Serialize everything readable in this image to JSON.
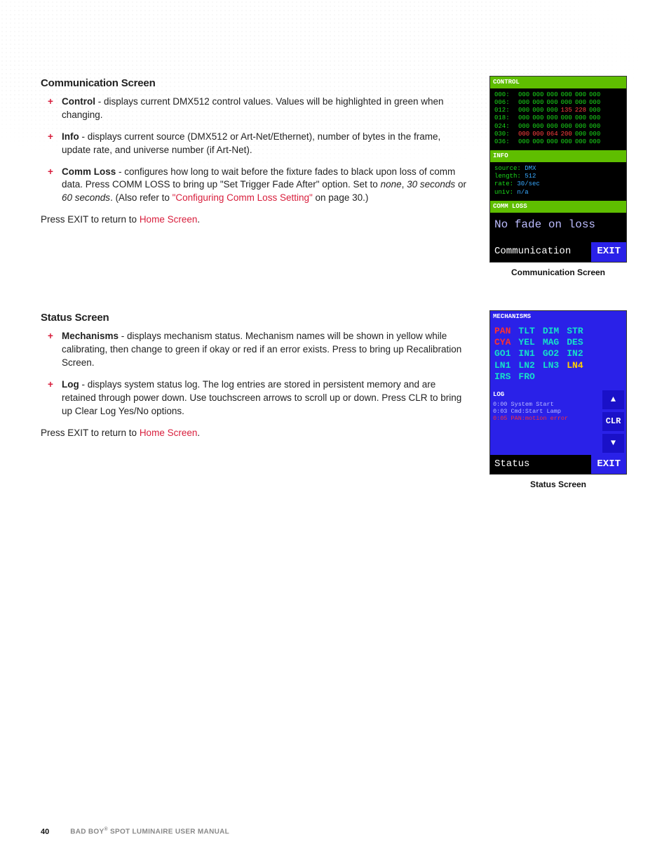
{
  "comm_section": {
    "heading": "Communication Screen",
    "items": [
      {
        "term": "Control",
        "text_after": " - displays current DMX512 control values. Values will be highlighted in green when changing."
      },
      {
        "term": "Info",
        "text_after": " - displays current source (DMX512 or Art-Net/Ethernet), number of bytes in the frame, update rate, and universe number (if Art-Net)."
      },
      {
        "term": "Comm Loss",
        "text_a": " - configures how long to wait before the fixture fades to black upon loss of comm data. Press COMM LOSS to bring up \"Set Trigger Fade After\" option. Set to ",
        "opts": [
          "none",
          "30 seconds",
          "60 seconds"
        ],
        "text_b": ". (Also refer to ",
        "link": "\"Configuring Comm Loss Setting\"",
        "text_c": " on page 30.)"
      }
    ],
    "exit_prefix": "Press EXIT to return to ",
    "exit_link": "Home Screen",
    "exit_suffix": "."
  },
  "status_section": {
    "heading": "Status Screen",
    "items": [
      {
        "term": "Mechanisms",
        "text_after": " - displays mechanism status. Mechanism names will be shown in yellow while calibrating, then change to green if okay or red if an error exists. Press to bring up Recalibration Screen."
      },
      {
        "term": "Log",
        "text_after": " - displays system status log. The log entries are stored in persistent memory and are retained through power down. Use touchscreen arrows to scroll up or down. Press CLR to bring up Clear Log Yes/No options."
      }
    ],
    "exit_prefix": "Press EXIT to return to ",
    "exit_link": "Home Screen",
    "exit_suffix": "."
  },
  "comm_screen": {
    "control_label": "CONTROL",
    "rows": [
      {
        "addr": "000:",
        "vals": [
          "000",
          "000",
          "000",
          "000",
          "000",
          "000"
        ]
      },
      {
        "addr": "006:",
        "vals": [
          "000",
          "000",
          "000",
          "000",
          "000",
          "000"
        ]
      },
      {
        "addr": "012:",
        "vals": [
          "000",
          "000",
          "000",
          "135",
          "228",
          "000"
        ],
        "hot": [
          3,
          4
        ]
      },
      {
        "addr": "018:",
        "vals": [
          "000",
          "000",
          "000",
          "000",
          "000",
          "000"
        ]
      },
      {
        "addr": "024:",
        "vals": [
          "000",
          "000",
          "000",
          "000",
          "000",
          "000"
        ]
      },
      {
        "addr": "030:",
        "vals": [
          "000",
          "000",
          "064",
          "200",
          "000",
          "000"
        ],
        "hot": [
          0,
          1,
          2,
          3
        ]
      },
      {
        "addr": "036:",
        "vals": [
          "000",
          "000",
          "000",
          "000",
          "000",
          "000"
        ]
      }
    ],
    "info_label": "INFO",
    "info": [
      {
        "k": "source:",
        "v": "DMX"
      },
      {
        "k": "length:",
        "v": "512"
      },
      {
        "k": "rate:",
        "v": "30/sec"
      },
      {
        "k": "univ:",
        "v": "n/a"
      }
    ],
    "commloss_label": "COMM LOSS",
    "commloss_value": "No fade on loss",
    "footer_left": "Communication",
    "footer_right": "EXIT",
    "caption": "Communication Screen"
  },
  "status_screen": {
    "mech_label": "MECHANISMS",
    "mech_rows": [
      [
        {
          "t": "PAN",
          "c": "r"
        },
        {
          "t": "TLT",
          "c": "g"
        },
        {
          "t": "DIM",
          "c": "g"
        },
        {
          "t": "STR",
          "c": "g"
        }
      ],
      [
        {
          "t": "CYA",
          "c": "r"
        },
        {
          "t": "YEL",
          "c": "g"
        },
        {
          "t": "MAG",
          "c": "g"
        },
        {
          "t": "DES",
          "c": "g"
        }
      ],
      [
        {
          "t": "GO1",
          "c": "g"
        },
        {
          "t": "IN1",
          "c": "g"
        },
        {
          "t": "GO2",
          "c": "g"
        },
        {
          "t": "IN2",
          "c": "g"
        }
      ],
      [
        {
          "t": "LN1",
          "c": "g"
        },
        {
          "t": "LN2",
          "c": "g"
        },
        {
          "t": "LN3",
          "c": "g"
        },
        {
          "t": "LN4",
          "c": "y"
        }
      ],
      [
        {
          "t": "IRS",
          "c": "g"
        },
        {
          "t": "FRO",
          "c": "g"
        }
      ]
    ],
    "log_label": "LOG",
    "log_lines": [
      {
        "t": "0:00 System Start",
        "err": false
      },
      {
        "t": "0:03 Cmd:Start Lamp",
        "err": false
      },
      {
        "t": "0:05 PAN:motion error",
        "err": true
      }
    ],
    "btn_up": "▲",
    "btn_clr": "CLR",
    "btn_down": "▼",
    "footer_left": "Status",
    "footer_right": "EXIT",
    "caption": "Status Screen"
  },
  "footer": {
    "page": "40",
    "title_a": "BAD BOY",
    "title_sup": "®",
    "title_b": " SPOT LUMINAIRE USER MANUAL"
  }
}
